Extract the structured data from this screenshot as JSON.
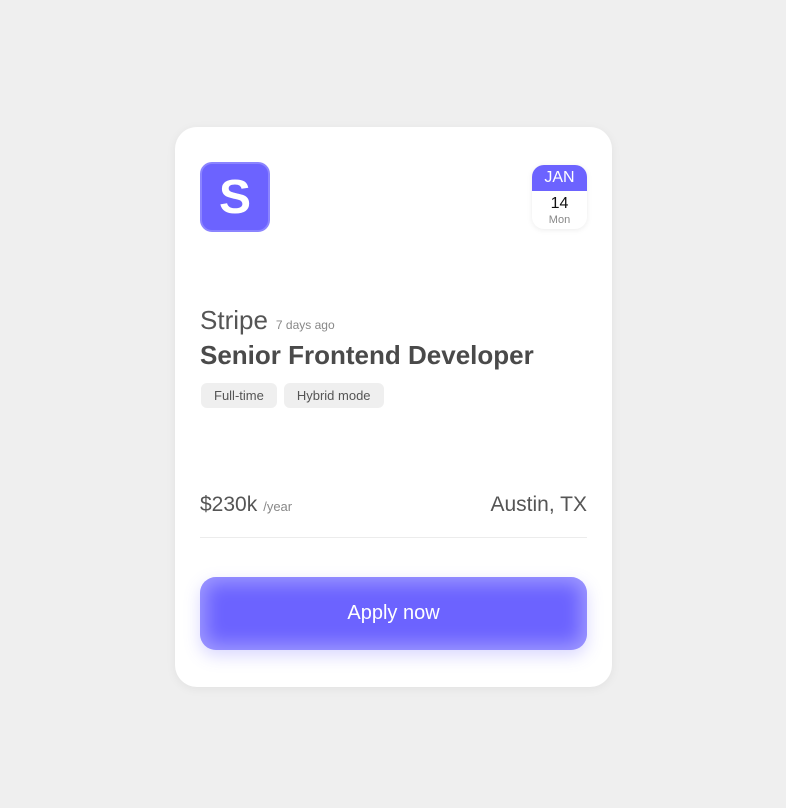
{
  "logo": {
    "letter": "S",
    "color": "#6c63ff"
  },
  "date": {
    "month": "JAN",
    "day": "14",
    "weekday": "Mon"
  },
  "company": {
    "name": "Stripe",
    "posted": "7 days ago"
  },
  "job": {
    "title": "Senior Frontend Developer",
    "tags": [
      "Full-time",
      "Hybrid mode"
    ]
  },
  "salary": {
    "amount": "$230k",
    "period": "/year"
  },
  "location": "Austin, TX",
  "apply_label": "Apply now",
  "colors": {
    "accent": "#6c63ff",
    "background": "#efefef",
    "card": "#ffffff"
  }
}
